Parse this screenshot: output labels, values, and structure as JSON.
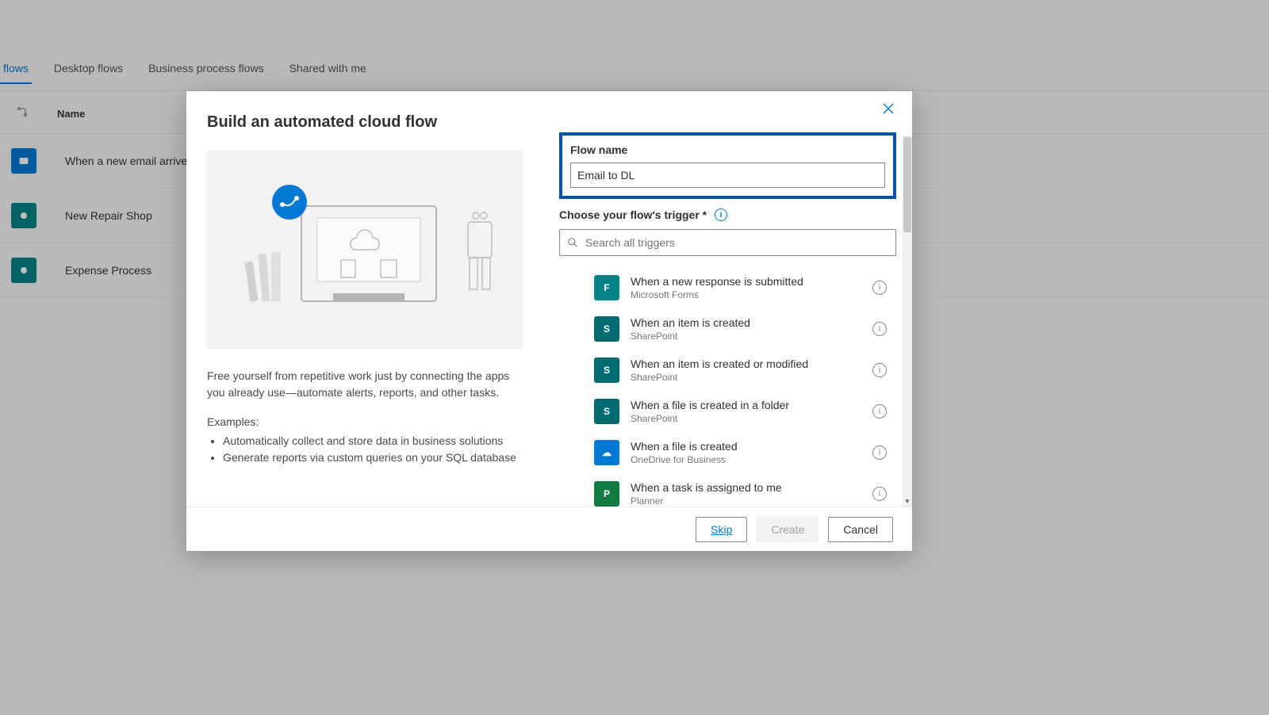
{
  "bg": {
    "tabs": [
      "flows",
      "Desktop flows",
      "Business process flows",
      "Shared with me"
    ],
    "name_header": "Name",
    "rows": [
      {
        "name": "When a new email arrives"
      },
      {
        "name": "New Repair Shop"
      },
      {
        "name": "Expense Process"
      }
    ]
  },
  "modal": {
    "title": "Build an automated cloud flow",
    "flow_name_label": "Flow name",
    "flow_name_value": "Email to DL",
    "trigger_label": "Choose your flow's trigger *",
    "search_placeholder": "Search all triggers",
    "desc": "Free yourself from repetitive work just by connecting the apps you already use—automate alerts, reports, and other tasks.",
    "examples_label": "Examples:",
    "examples": [
      "Automatically collect and store data in business solutions",
      "Generate reports via custom queries on your SQL database"
    ],
    "triggers": [
      {
        "title": "When a new response is submitted",
        "sub": "Microsoft Forms",
        "icon": "forms"
      },
      {
        "title": "When an item is created",
        "sub": "SharePoint",
        "icon": "sp"
      },
      {
        "title": "When an item is created or modified",
        "sub": "SharePoint",
        "icon": "sp"
      },
      {
        "title": "When a file is created in a folder",
        "sub": "SharePoint",
        "icon": "sp"
      },
      {
        "title": "When a file is created",
        "sub": "OneDrive for Business",
        "icon": "od"
      },
      {
        "title": "When a task is assigned to me",
        "sub": "Planner",
        "icon": "planner"
      }
    ],
    "buttons": {
      "skip": "Skip",
      "create": "Create",
      "cancel": "Cancel"
    }
  }
}
